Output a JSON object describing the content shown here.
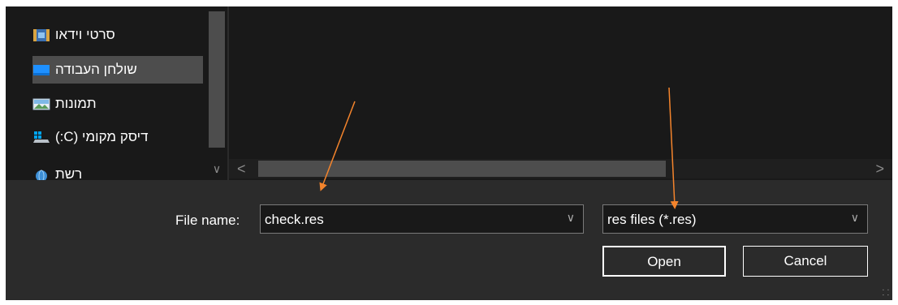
{
  "nav": {
    "items": [
      {
        "label": "סרטי וידאו",
        "icon": "videos-folder-icon"
      },
      {
        "label": "שולחן העבודה",
        "icon": "desktop-folder-icon"
      },
      {
        "label": "תמונות",
        "icon": "pictures-folder-icon"
      },
      {
        "label": "דיסק מקומי (C:)",
        "icon": "local-disk-icon"
      },
      {
        "label": "רשת",
        "icon": "network-icon"
      }
    ]
  },
  "scroll": {
    "left_arrow": "<",
    "right_arrow": ">",
    "down_arrow": "∨"
  },
  "footer": {
    "filename_label": "File name:",
    "filename_value": "check.res",
    "filetype_value": "res files (*.res)",
    "open_label": "Open",
    "cancel_label": "Cancel"
  },
  "colors": {
    "annotation_arrow": "#f4842c",
    "dialog_bg": "#191919",
    "panel_bg": "#2b2b2b"
  }
}
